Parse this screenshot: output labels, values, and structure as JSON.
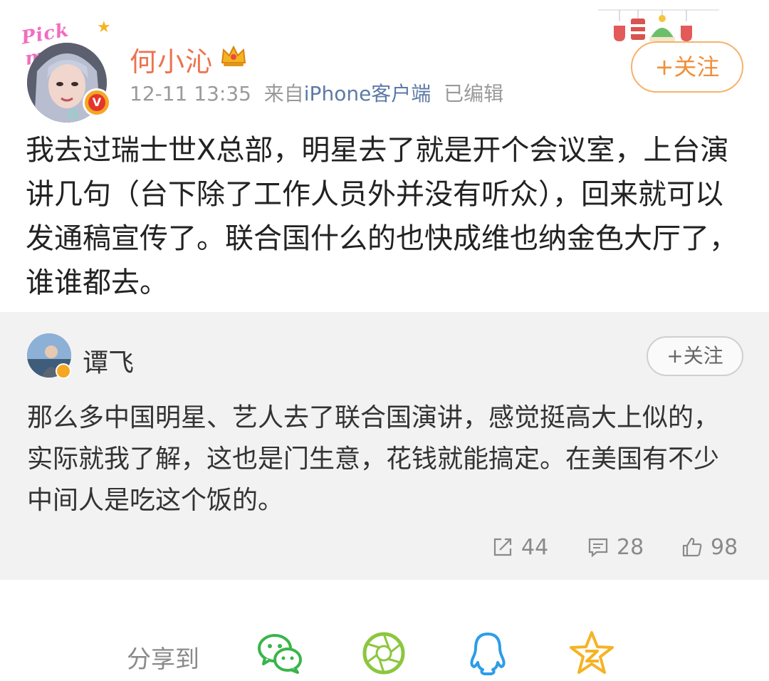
{
  "post": {
    "avatar_caption": "Pick me",
    "badge_letter": "V",
    "username": "何小沁",
    "time": "12-11 13:35",
    "source_prefix": "来自",
    "source": "iPhone客户端",
    "edited": "已编辑",
    "follow_label": "+关注",
    "text": "我去过瑞士世X总部，明星去了就是开个会议室，上台演讲几句（台下除了工作人员外并没有听众），回来就可以发通稿宣传了。联合国什么的也快成维也纳金色大厅了，谁谁都去。"
  },
  "retweet": {
    "username": "谭飞",
    "follow_label": "+关注",
    "text": "那么多中国明星、艺人去了联合国演讲，感觉挺高大上似的，实际就我了解，这也是门生意，花钱就能搞定。在美国有不少中间人是吃这个饭的。",
    "reposts": "44",
    "comments": "28",
    "likes": "98"
  },
  "share": {
    "label": "分享到",
    "targets": [
      "wechat-icon",
      "moments-icon",
      "qq-icon",
      "qzone-icon"
    ]
  },
  "colors": {
    "username": "#eb7350",
    "follow_border": "#f6b26b",
    "source_link": "#5d7aa6",
    "retweet_bg": "#f2f2f2"
  }
}
